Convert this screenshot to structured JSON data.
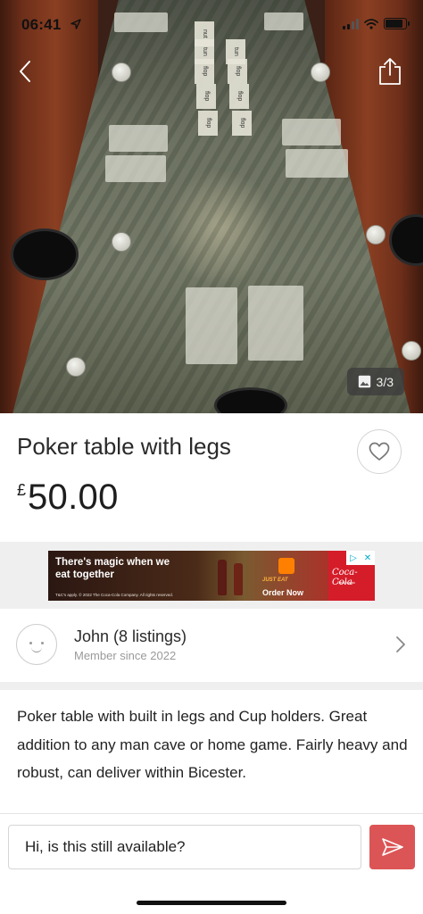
{
  "status_bar": {
    "time": "06:41"
  },
  "photo": {
    "counter": "3/3",
    "table_card_text": [
      "nut",
      "tun",
      "tun",
      "flop",
      "flop",
      "flop",
      "flop",
      "flop",
      "flop"
    ]
  },
  "listing": {
    "title": "Poker table with legs",
    "currency": "£",
    "price": "50.00"
  },
  "ad": {
    "headline": "There's magic when we eat together",
    "fine_print": "T&C's apply. © 2022 The Coca-Cola Company. All rights reserved.",
    "partner": "JUST EAT",
    "cta": "Order Now",
    "brand": "Coca-Cola",
    "brand_tagline": "Real Magic"
  },
  "seller": {
    "name": "John (8 listings)",
    "member_since": "Member since 2022"
  },
  "description": "Poker table with built in legs and Cup holders. Great addition to any man cave or home game. Fairly heavy and robust, can deliver within Bicester.",
  "message": {
    "draft": "Hi, is this still available?"
  },
  "colors": {
    "send_button": "#dc5556",
    "background": "#ffffff",
    "separator": "#efefef"
  },
  "icons": [
    "location-arrow-icon",
    "signal-icon",
    "wifi-icon",
    "battery-icon",
    "back-icon",
    "share-icon",
    "image-icon",
    "heart-icon",
    "chevron-right-icon",
    "send-icon"
  ]
}
